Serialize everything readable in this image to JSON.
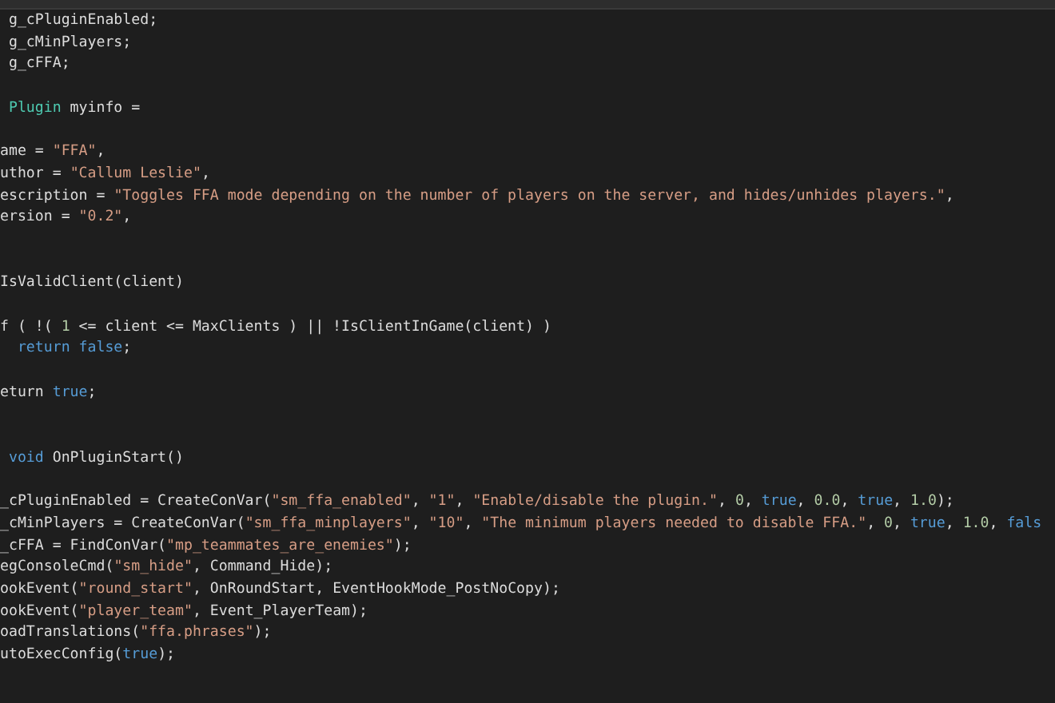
{
  "lines": [
    {
      "kind": "code",
      "tokens": [
        {
          "kind": "text",
          "text": " g_cPluginEnabled;"
        }
      ]
    },
    {
      "kind": "code",
      "tokens": [
        {
          "kind": "text",
          "text": " g_cMinPlayers;"
        }
      ]
    },
    {
      "kind": "code",
      "tokens": [
        {
          "kind": "text",
          "text": " g_cFFA;"
        }
      ]
    },
    {
      "kind": "blank"
    },
    {
      "kind": "code",
      "tokens": [
        {
          "kind": "type",
          "text": " Plugin"
        },
        {
          "kind": "text",
          "text": " myinfo ="
        }
      ]
    },
    {
      "kind": "blank"
    },
    {
      "kind": "code",
      "tokens": [
        {
          "kind": "text",
          "text": "ame = "
        },
        {
          "kind": "string",
          "text": "\"FFA\""
        },
        {
          "kind": "text",
          "text": ","
        }
      ]
    },
    {
      "kind": "code",
      "tokens": [
        {
          "kind": "text",
          "text": "uthor = "
        },
        {
          "kind": "string",
          "text": "\"Callum Leslie\""
        },
        {
          "kind": "text",
          "text": ","
        }
      ]
    },
    {
      "kind": "code",
      "tokens": [
        {
          "kind": "text",
          "text": "escription = "
        },
        {
          "kind": "string",
          "text": "\"Toggles FFA mode depending on the number of players on the server, and hides/unhides players.\""
        },
        {
          "kind": "text",
          "text": ","
        }
      ]
    },
    {
      "kind": "code",
      "tokens": [
        {
          "kind": "text",
          "text": "ersion = "
        },
        {
          "kind": "string",
          "text": "\"0.2\""
        },
        {
          "kind": "text",
          "text": ","
        }
      ]
    },
    {
      "kind": "blank"
    },
    {
      "kind": "blank"
    },
    {
      "kind": "code",
      "tokens": [
        {
          "kind": "text",
          "text": "IsValidClient(client)"
        }
      ]
    },
    {
      "kind": "blank"
    },
    {
      "kind": "code",
      "tokens": [
        {
          "kind": "text",
          "text": "f ( !( "
        },
        {
          "kind": "number",
          "text": "1"
        },
        {
          "kind": "text",
          "text": " <= client <= MaxClients ) || !IsClientInGame(client) )"
        }
      ]
    },
    {
      "kind": "code",
      "tokens": [
        {
          "kind": "keyword",
          "text": "  return false"
        },
        {
          "kind": "text",
          "text": ";"
        }
      ]
    },
    {
      "kind": "blank"
    },
    {
      "kind": "code",
      "tokens": [
        {
          "kind": "text",
          "text": "eturn "
        },
        {
          "kind": "keyword",
          "text": "true"
        },
        {
          "kind": "text",
          "text": ";"
        }
      ]
    },
    {
      "kind": "blank"
    },
    {
      "kind": "blank"
    },
    {
      "kind": "code",
      "tokens": [
        {
          "kind": "keyword",
          "text": " void"
        },
        {
          "kind": "text",
          "text": " OnPluginStart()"
        }
      ]
    },
    {
      "kind": "blank"
    },
    {
      "kind": "code",
      "tokens": [
        {
          "kind": "text",
          "text": "_cPluginEnabled = CreateConVar("
        },
        {
          "kind": "string",
          "text": "\"sm_ffa_enabled\""
        },
        {
          "kind": "text",
          "text": ", "
        },
        {
          "kind": "string",
          "text": "\"1\""
        },
        {
          "kind": "text",
          "text": ", "
        },
        {
          "kind": "string",
          "text": "\"Enable/disable the plugin.\""
        },
        {
          "kind": "text",
          "text": ", "
        },
        {
          "kind": "number",
          "text": "0"
        },
        {
          "kind": "text",
          "text": ", "
        },
        {
          "kind": "keyword",
          "text": "true"
        },
        {
          "kind": "text",
          "text": ", "
        },
        {
          "kind": "number",
          "text": "0.0"
        },
        {
          "kind": "text",
          "text": ", "
        },
        {
          "kind": "keyword",
          "text": "true"
        },
        {
          "kind": "text",
          "text": ", "
        },
        {
          "kind": "number",
          "text": "1.0"
        },
        {
          "kind": "text",
          "text": ");"
        }
      ]
    },
    {
      "kind": "code",
      "tokens": [
        {
          "kind": "text",
          "text": "_cMinPlayers = CreateConVar("
        },
        {
          "kind": "string",
          "text": "\"sm_ffa_minplayers\""
        },
        {
          "kind": "text",
          "text": ", "
        },
        {
          "kind": "string",
          "text": "\"10\""
        },
        {
          "kind": "text",
          "text": ", "
        },
        {
          "kind": "string",
          "text": "\"The minimum players needed to disable FFA.\""
        },
        {
          "kind": "text",
          "text": ", "
        },
        {
          "kind": "number",
          "text": "0"
        },
        {
          "kind": "text",
          "text": ", "
        },
        {
          "kind": "keyword",
          "text": "true"
        },
        {
          "kind": "text",
          "text": ", "
        },
        {
          "kind": "number",
          "text": "1.0"
        },
        {
          "kind": "text",
          "text": ", "
        },
        {
          "kind": "keyword",
          "text": "fals"
        }
      ]
    },
    {
      "kind": "code",
      "tokens": [
        {
          "kind": "text",
          "text": "_cFFA = FindConVar("
        },
        {
          "kind": "string",
          "text": "\"mp_teammates_are_enemies\""
        },
        {
          "kind": "text",
          "text": ");"
        }
      ]
    },
    {
      "kind": "code",
      "tokens": [
        {
          "kind": "text",
          "text": "egConsoleCmd("
        },
        {
          "kind": "string",
          "text": "\"sm_hide\""
        },
        {
          "kind": "text",
          "text": ", Command_Hide);"
        }
      ]
    },
    {
      "kind": "code",
      "tokens": [
        {
          "kind": "text",
          "text": "ookEvent("
        },
        {
          "kind": "string",
          "text": "\"round_start\""
        },
        {
          "kind": "text",
          "text": ", OnRoundStart, EventHookMode_PostNoCopy);"
        }
      ]
    },
    {
      "kind": "code",
      "tokens": [
        {
          "kind": "text",
          "text": "ookEvent("
        },
        {
          "kind": "string",
          "text": "\"player_team\""
        },
        {
          "kind": "text",
          "text": ", Event_PlayerTeam);"
        }
      ]
    },
    {
      "kind": "code",
      "tokens": [
        {
          "kind": "text",
          "text": "oadTranslations("
        },
        {
          "kind": "string",
          "text": "\"ffa.phrases\""
        },
        {
          "kind": "text",
          "text": ");"
        }
      ]
    },
    {
      "kind": "code",
      "tokens": [
        {
          "kind": "text",
          "text": "utoExecConfig("
        },
        {
          "kind": "keyword",
          "text": "true"
        },
        {
          "kind": "text",
          "text": ");"
        }
      ]
    }
  ]
}
